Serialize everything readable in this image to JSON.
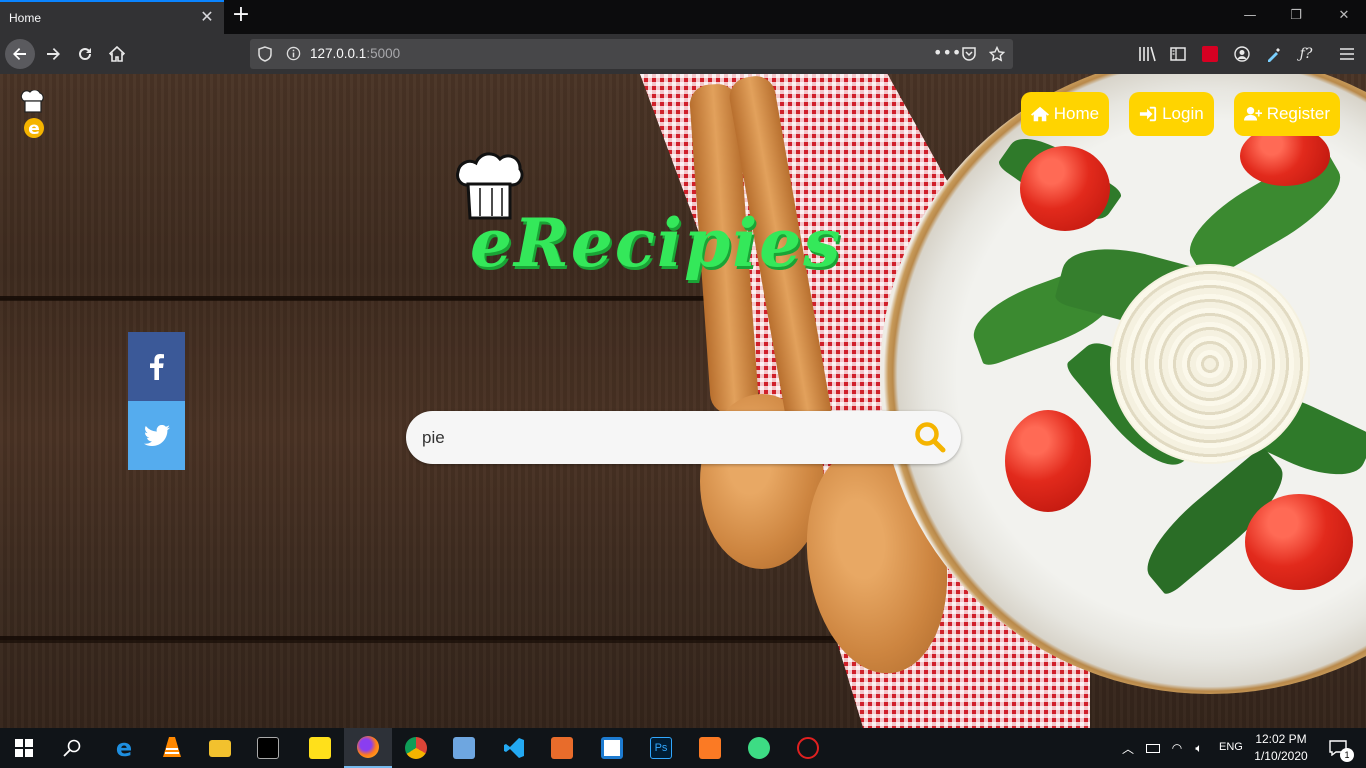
{
  "browser": {
    "tab_title": "Home",
    "url_host": "127.0.0.1",
    "url_port": ":5000"
  },
  "page": {
    "brand_title": "eRecipies",
    "nav": [
      {
        "label": "Home",
        "icon": "home-icon"
      },
      {
        "label": "Login",
        "icon": "login-icon"
      },
      {
        "label": "Register",
        "icon": "register-icon"
      }
    ],
    "search": {
      "value": "pie"
    },
    "social": [
      "facebook-icon",
      "twitter-icon"
    ]
  },
  "colors": {
    "nav_button": "#ffd400",
    "brand_green": "#34e85a",
    "facebook": "#3b5998",
    "twitter": "#55acee",
    "search_icon": "#f5b400"
  },
  "taskbar": {
    "language": "ENG",
    "time": "12:02 PM",
    "date": "1/10/2020",
    "notification_count": "1"
  }
}
